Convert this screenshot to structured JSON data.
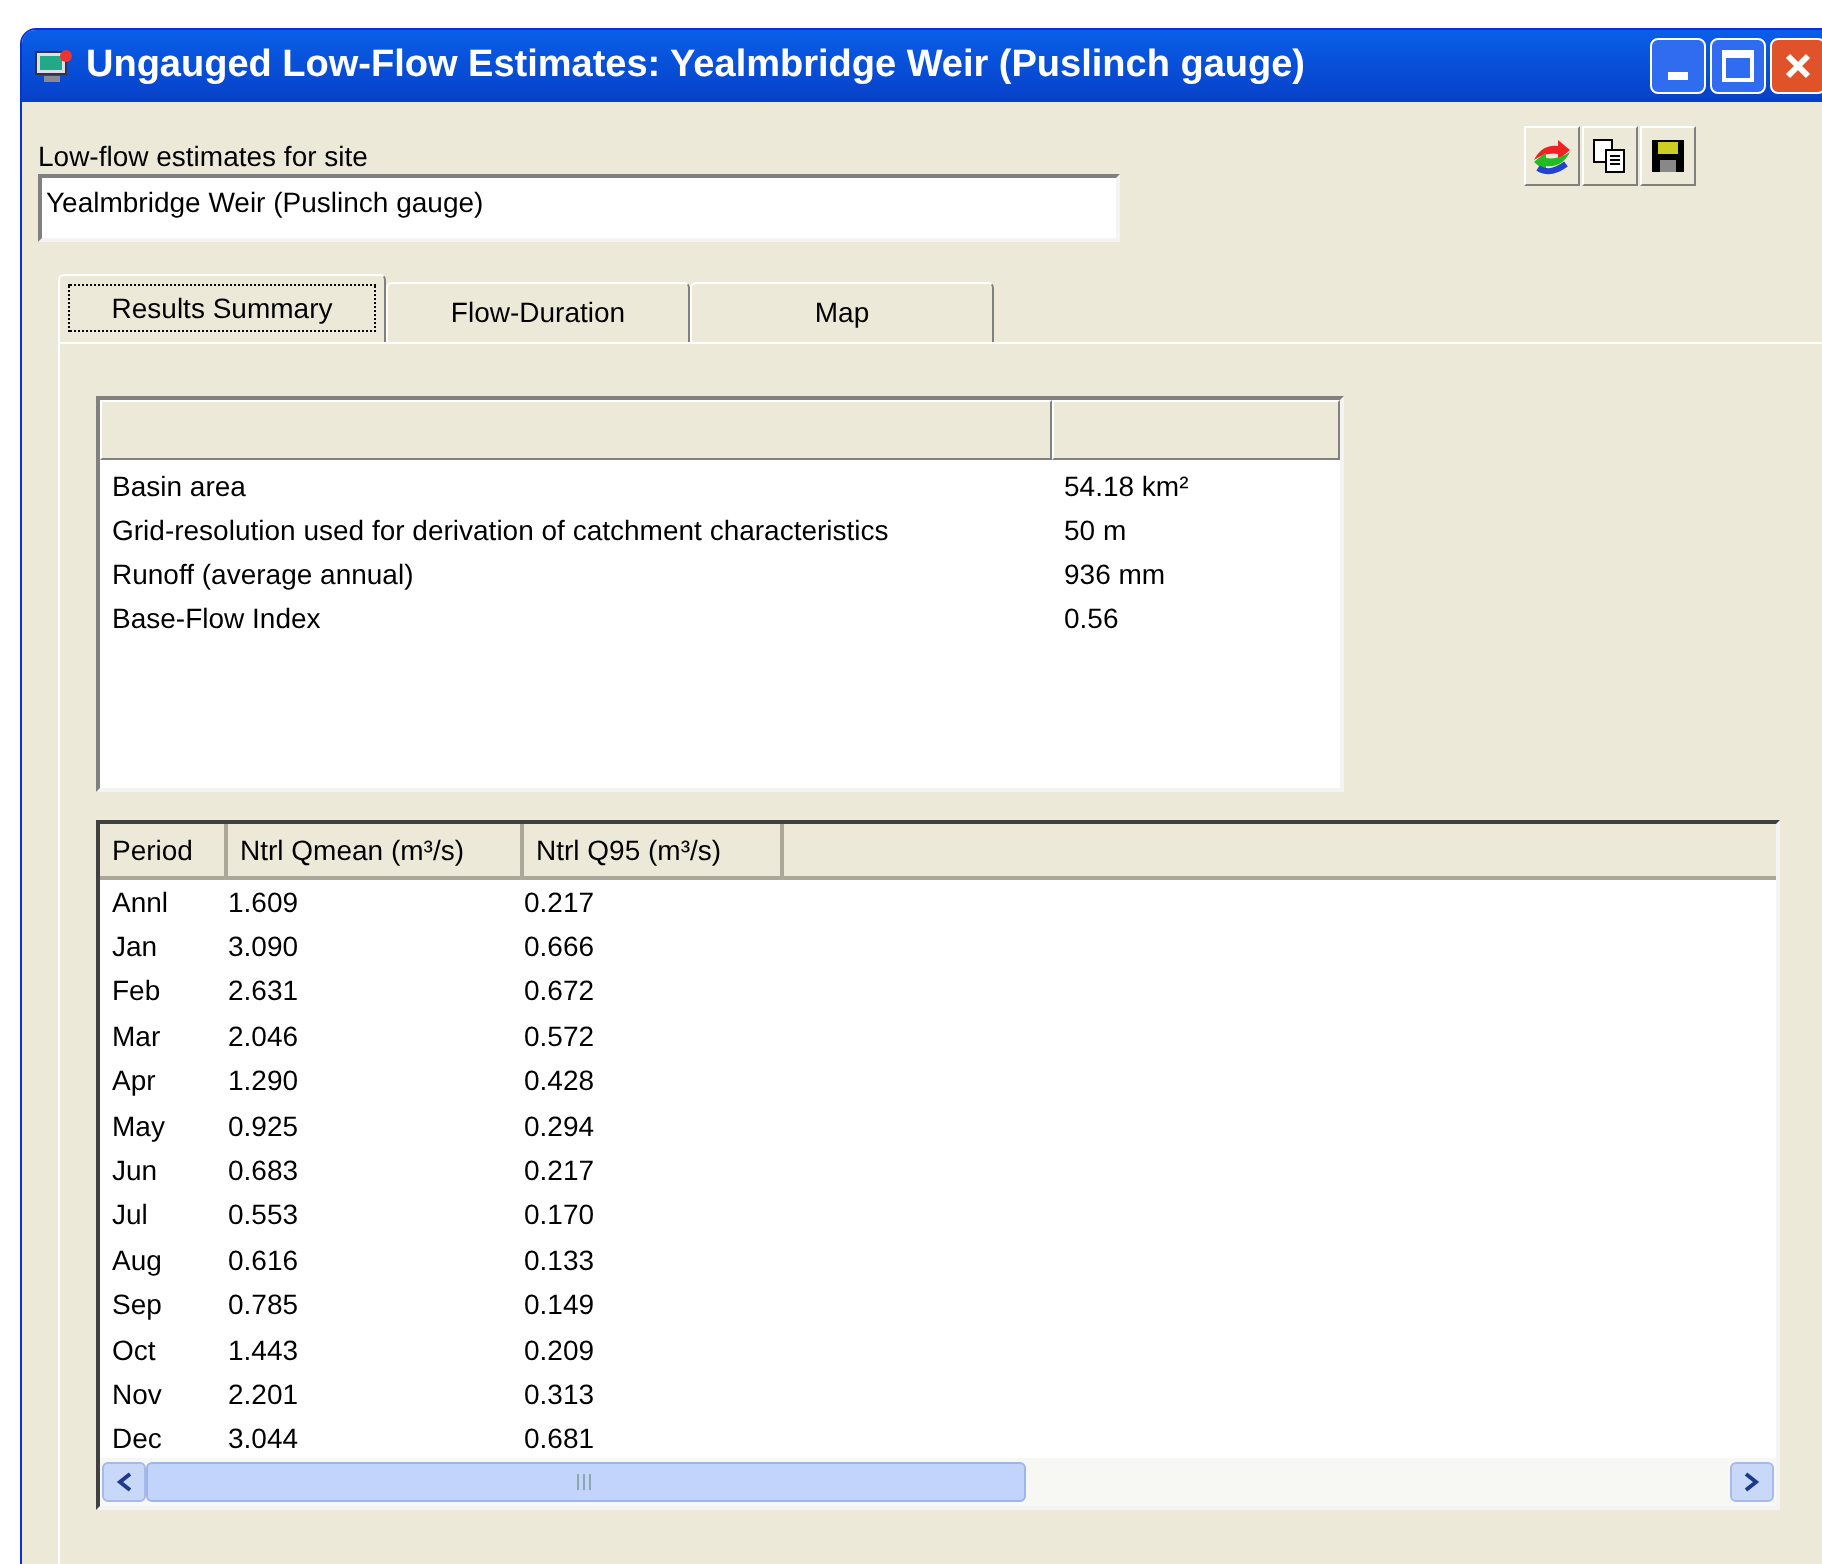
{
  "window": {
    "title": "Ungauged Low-Flow Estimates: Yealmbridge Weir (Puslinch gauge)"
  },
  "site": {
    "label": "Low-flow estimates for site",
    "value": "Yealmbridge Weir (Puslinch gauge)"
  },
  "tabs": [
    {
      "label": "Results Summary",
      "selected": true
    },
    {
      "label": "Flow-Duration",
      "selected": false
    },
    {
      "label": "Map",
      "selected": false
    }
  ],
  "summary": {
    "rows": [
      {
        "name": "Basin area",
        "value": "54.18 km²"
      },
      {
        "name": "Grid-resolution used for derivation of catchment characteristics",
        "value": "50 m"
      },
      {
        "name": "Runoff (average annual)",
        "value": "936 mm"
      },
      {
        "name": "Base-Flow Index",
        "value": "0.56"
      }
    ]
  },
  "table": {
    "columns": [
      "Period",
      "Ntrl Qmean (m³/s)",
      "Ntrl Q95 (m³/s)"
    ],
    "rows": [
      [
        "Annl",
        "1.609",
        "0.217"
      ],
      [
        "Jan",
        "3.090",
        "0.666"
      ],
      [
        "Feb",
        "2.631",
        "0.672"
      ],
      [
        "Mar",
        "2.046",
        "0.572"
      ],
      [
        "Apr",
        "1.290",
        "0.428"
      ],
      [
        "May",
        "0.925",
        "0.294"
      ],
      [
        "Jun",
        "0.683",
        "0.217"
      ],
      [
        "Jul",
        "0.553",
        "0.170"
      ],
      [
        "Aug",
        "0.616",
        "0.133"
      ],
      [
        "Sep",
        "0.785",
        "0.149"
      ],
      [
        "Oct",
        "1.443",
        "0.209"
      ],
      [
        "Nov",
        "2.201",
        "0.313"
      ],
      [
        "Dec",
        "3.044",
        "0.681"
      ]
    ]
  }
}
